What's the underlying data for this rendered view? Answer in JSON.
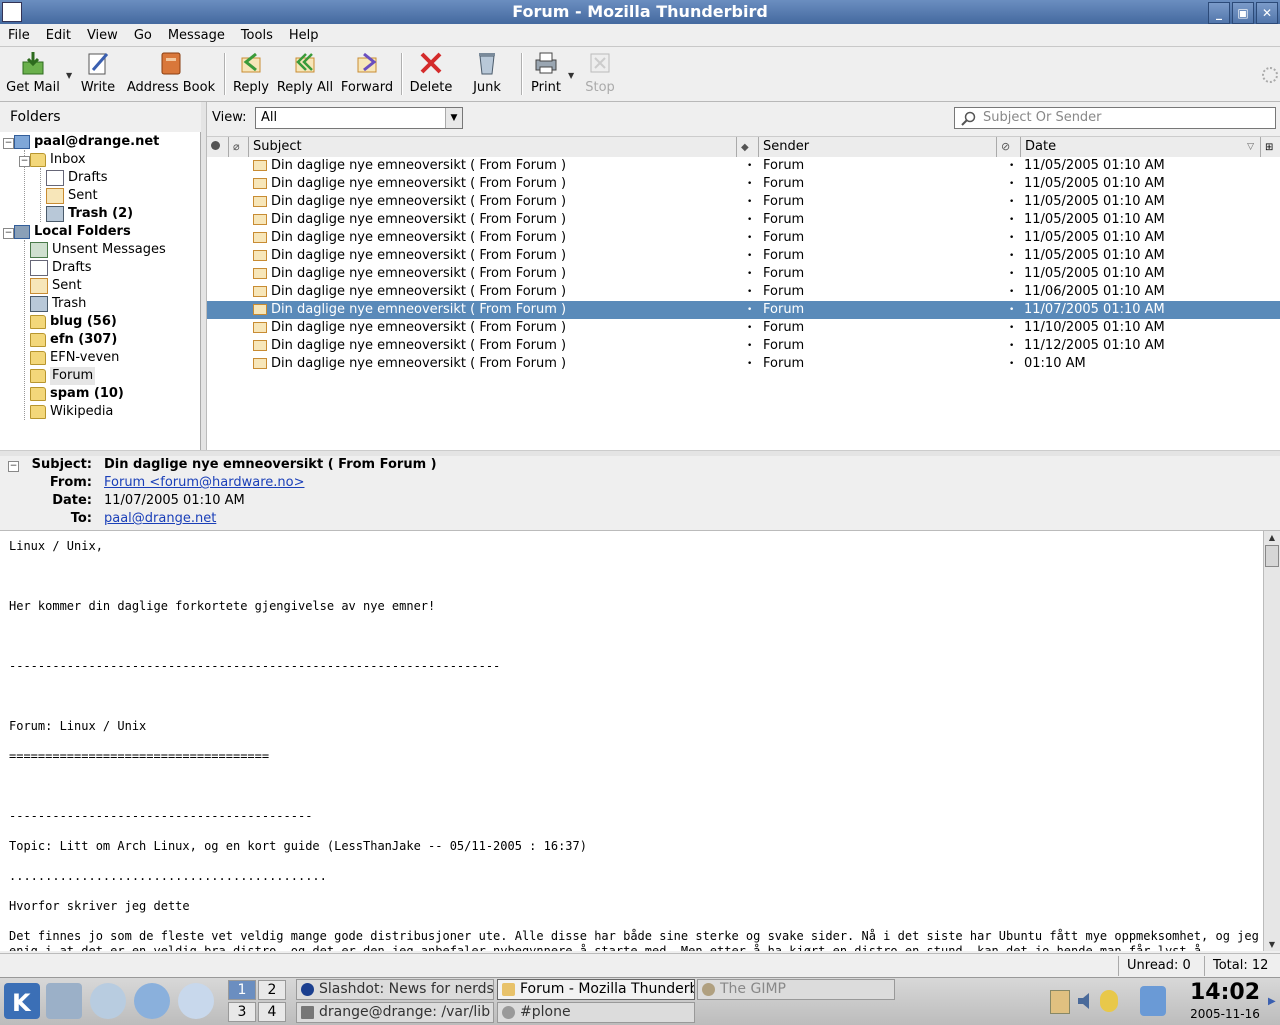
{
  "window": {
    "title": "Forum - Mozilla Thunderbird"
  },
  "menu": [
    "File",
    "Edit",
    "View",
    "Go",
    "Message",
    "Tools",
    "Help"
  ],
  "toolbar": {
    "get_mail": "Get Mail",
    "write": "Write",
    "address_book": "Address Book",
    "reply": "Reply",
    "reply_all": "Reply All",
    "forward": "Forward",
    "delete": "Delete",
    "junk": "Junk",
    "print": "Print",
    "stop": "Stop"
  },
  "folders": {
    "header": "Folders",
    "items": [
      {
        "label": "paal@drange.net",
        "bold": true
      },
      {
        "label": "Inbox"
      },
      {
        "label": "Drafts"
      },
      {
        "label": "Sent"
      },
      {
        "label": "Trash (2)",
        "bold": true
      },
      {
        "label": "Local Folders",
        "bold": true
      },
      {
        "label": "Unsent Messages"
      },
      {
        "label": "Drafts"
      },
      {
        "label": "Sent"
      },
      {
        "label": "Trash"
      },
      {
        "label": "blug (56)",
        "bold": true
      },
      {
        "label": "efn (307)",
        "bold": true
      },
      {
        "label": "EFN-veven"
      },
      {
        "label": "Forum",
        "selected": true
      },
      {
        "label": "spam (10)",
        "bold": true
      },
      {
        "label": "Wikipedia"
      }
    ]
  },
  "view": {
    "label": "View:",
    "value": "All"
  },
  "search": {
    "placeholder": "Subject Or Sender"
  },
  "thread": {
    "columns": {
      "subject": "Subject",
      "sender": "Sender",
      "date": "Date"
    },
    "rows": [
      {
        "subject": "Din daglige nye emneoversikt ( From Forum )",
        "sender": "Forum",
        "date": "11/05/2005 01:10 AM"
      },
      {
        "subject": "Din daglige nye emneoversikt ( From Forum )",
        "sender": "Forum",
        "date": "11/05/2005 01:10 AM"
      },
      {
        "subject": "Din daglige nye emneoversikt ( From Forum )",
        "sender": "Forum",
        "date": "11/05/2005 01:10 AM"
      },
      {
        "subject": "Din daglige nye emneoversikt ( From Forum )",
        "sender": "Forum",
        "date": "11/05/2005 01:10 AM"
      },
      {
        "subject": "Din daglige nye emneoversikt ( From Forum )",
        "sender": "Forum",
        "date": "11/05/2005 01:10 AM"
      },
      {
        "subject": "Din daglige nye emneoversikt ( From Forum )",
        "sender": "Forum",
        "date": "11/05/2005 01:10 AM"
      },
      {
        "subject": "Din daglige nye emneoversikt ( From Forum )",
        "sender": "Forum",
        "date": "11/05/2005 01:10 AM"
      },
      {
        "subject": "Din daglige nye emneoversikt ( From Forum )",
        "sender": "Forum",
        "date": "11/06/2005 01:10 AM"
      },
      {
        "subject": "Din daglige nye emneoversikt ( From Forum )",
        "sender": "Forum",
        "date": "11/07/2005 01:10 AM",
        "selected": true
      },
      {
        "subject": "Din daglige nye emneoversikt ( From Forum )",
        "sender": "Forum",
        "date": "11/10/2005 01:10 AM"
      },
      {
        "subject": "Din daglige nye emneoversikt ( From Forum )",
        "sender": "Forum",
        "date": "11/12/2005 01:10 AM"
      },
      {
        "subject": "Din daglige nye emneoversikt ( From Forum )",
        "sender": "Forum",
        "date": "01:10 AM"
      }
    ]
  },
  "message": {
    "labels": {
      "subject": "Subject:",
      "from": "From:",
      "date": "Date:",
      "to": "To:"
    },
    "subject": "Din daglige nye emneoversikt ( From Forum )",
    "from": "Forum <forum@hardware.no>",
    "date": "11/07/2005 01:10 AM",
    "to": "paal@drange.net",
    "body": "Linux / Unix,\n\n\n\nHer kommer din daglige forkortete gjengivelse av nye emner!\n\n\n\n--------------------------------------------------------------------\n\n\n\nForum: Linux / Unix\n\n====================================\n\n\n\n------------------------------------------\n\nTopic: Litt om Arch Linux, og en kort guide (LessThanJake -- 05/11-2005 : 16:37)\n\n............................................\n\nHvorfor skriver jeg dette\n\nDet finnes jo som de fleste vet veldig mange gode distribusjoner ute. Alle disse har både sine sterke og svake sider. Nå i det siste har Ubuntu fått mye oppmeksomhet, og jeg er\nenig i at det er en veldig bra distro, og det er den jeg anbefaler nybegynnere å starte med. Men etter å ha kjørt en distro en stund, kan det jo hende man får lyst å"
  },
  "status": {
    "unread": "Unread: 0",
    "total": "Total: 12"
  },
  "taskbar": {
    "desktops": [
      "1",
      "2",
      "3",
      "4"
    ],
    "tasks": [
      {
        "label": "Slashdot: News for nerds",
        "color": "#1b3f8f"
      },
      {
        "label": "Forum - Mozilla Thunderbird",
        "color": "#e8c26a",
        "active": true
      },
      {
        "label": "The GIMP",
        "color": "#b0a080",
        "dim": true
      },
      {
        "label": "drange@drange: /var/lib",
        "color": "#777"
      },
      {
        "label": "#plone",
        "color": "#999"
      }
    ],
    "clock_time": "14:02",
    "clock_date": "2005-11-16"
  }
}
